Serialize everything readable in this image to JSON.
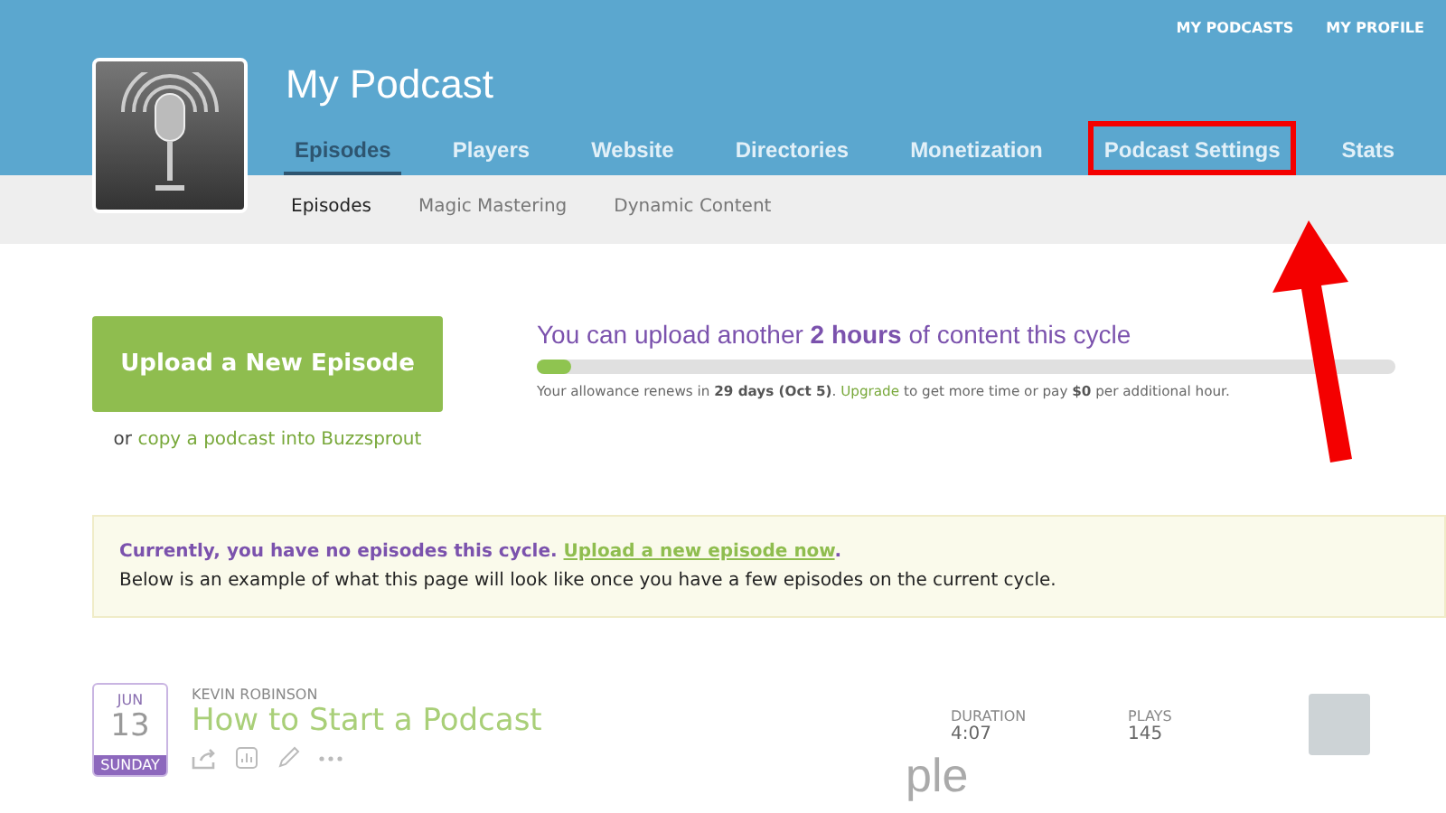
{
  "top_links": [
    "MY PODCASTS",
    "MY PROFILE"
  ],
  "podcast": {
    "title": "My Podcast"
  },
  "tabs": [
    {
      "label": "Episodes",
      "selected": true,
      "highlighted": false
    },
    {
      "label": "Players",
      "selected": false,
      "highlighted": false
    },
    {
      "label": "Website",
      "selected": false,
      "highlighted": false
    },
    {
      "label": "Directories",
      "selected": false,
      "highlighted": false
    },
    {
      "label": "Monetization",
      "selected": false,
      "highlighted": false
    },
    {
      "label": "Podcast Settings",
      "selected": false,
      "highlighted": true
    },
    {
      "label": "Stats",
      "selected": false,
      "highlighted": false
    }
  ],
  "subtabs": [
    {
      "label": "Episodes",
      "selected": true
    },
    {
      "label": "Magic Mastering",
      "selected": false
    },
    {
      "label": "Dynamic Content",
      "selected": false
    }
  ],
  "upload": {
    "button": "Upload a New Episode",
    "alt_prefix": "or",
    "alt_link": "copy a podcast into Buzzsprout"
  },
  "allowance": {
    "headline": "You can upload another **2 hours** of content this cycle",
    "level": 0.04,
    "note_before": "Your allowance renews in **29 days (Oct 5)**.",
    "note_link": "Upgrade",
    "note_after": "to get more time or pay **$0** per additional hour."
  },
  "notice": {
    "lead": "Currently, you have no episodes this cycle.",
    "link": "Upload a new episode now",
    "trail": ".",
    "body": "Below is an example of what this page will look like once you have a few episodes on the current cycle."
  },
  "example_episode": {
    "month": "JUN",
    "day": "13",
    "weekday": "SUNDAY",
    "author": "KEVIN ROBINSON",
    "title": "How to Start a Podcast",
    "duration_label": "DURATION",
    "duration": "4:07",
    "plays_label": "PLAYS",
    "plays": "145",
    "stamp": "ple"
  }
}
